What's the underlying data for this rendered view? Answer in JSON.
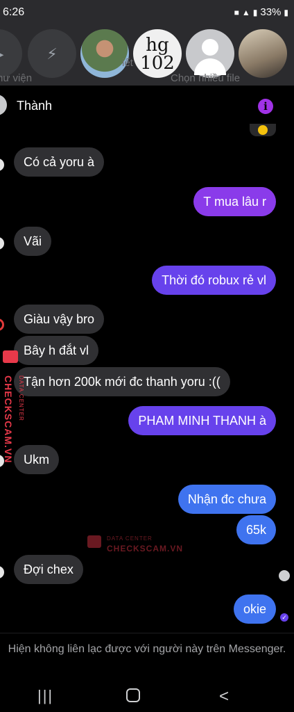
{
  "status_bar": {
    "time": "6:26",
    "battery": "33%"
  },
  "story_strip": {
    "story3_label": "hg\n102",
    "caption_left": "hư viện",
    "caption_right": "Chọn nhiều file",
    "caption_mid": "iết"
  },
  "chat": {
    "contact_name": "Thành",
    "messages": [
      {
        "dir": "in",
        "text": "Có cả yoru à"
      },
      {
        "dir": "out",
        "text": "T mua lâu r"
      },
      {
        "dir": "in",
        "text": "Vãi"
      },
      {
        "dir": "out",
        "text": "Thời đó robux rẻ vl"
      },
      {
        "dir": "in",
        "text": "Giàu vậy bro"
      },
      {
        "dir": "in",
        "text": "Bây h đắt vl"
      },
      {
        "dir": "in",
        "text": "Tận hơn 200k mới đc thanh yoru :(("
      },
      {
        "dir": "out",
        "text": "PHAM MINH THANH à"
      },
      {
        "dir": "in",
        "text": "Ukm"
      },
      {
        "dir": "out",
        "text": "Nhận đc chưa"
      },
      {
        "dir": "out",
        "text": "65k"
      },
      {
        "dir": "in",
        "text": "Đợi chex"
      },
      {
        "dir": "out",
        "text": "okie"
      }
    ]
  },
  "watermark": {
    "side_text": "CHECKSCAM.VN",
    "side_small": "DATA CENTER",
    "center_line1": "DATA CENTER",
    "center_line2": "CHECKSCAM.VN"
  },
  "notice": "Hiện không liên lạc được với người này trên Messenger.",
  "navigation": {
    "recents": "|||",
    "back": "<"
  },
  "colors": {
    "incoming": "#303033",
    "outgoing_purple": "#8a3bea",
    "outgoing_violet": "#6742ec",
    "outgoing_blue": "#3f73ef",
    "info_icon": "#a032e6"
  }
}
